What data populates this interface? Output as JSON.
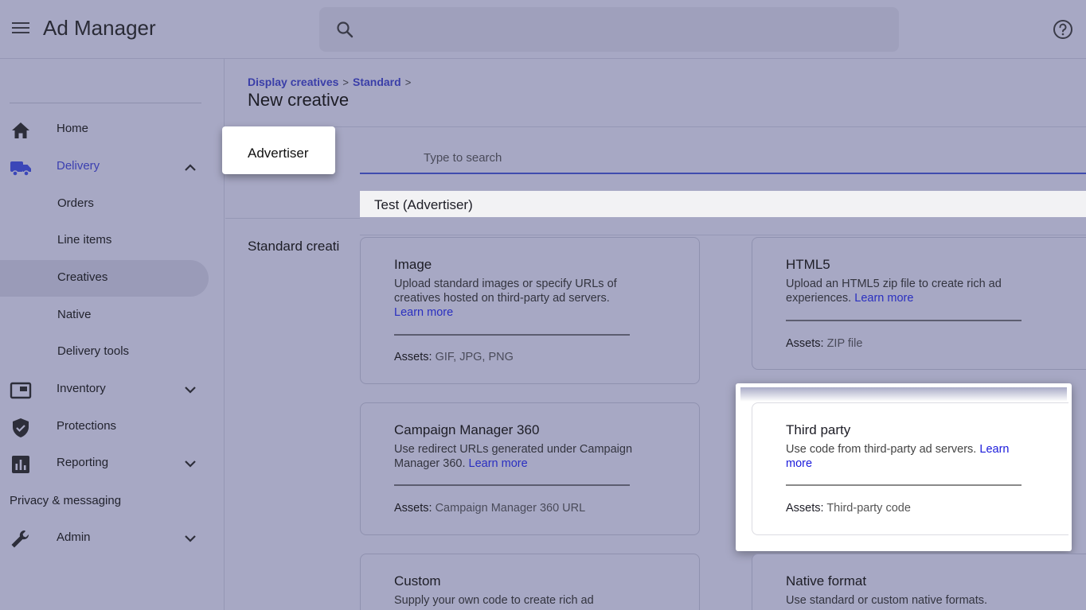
{
  "header": {
    "app_title": "Ad Manager",
    "search_placeholder": "",
    "icons": {
      "menu": "menu-icon",
      "search": "search-icon",
      "help": "help-icon"
    }
  },
  "sidebar": {
    "items": [
      {
        "label": "Home",
        "icon": "home-icon"
      },
      {
        "label": "Delivery",
        "icon": "truck-icon",
        "expanded": true
      },
      {
        "label": "Orders"
      },
      {
        "label": "Line items"
      },
      {
        "label": "Creatives",
        "selected": true
      },
      {
        "label": "Native"
      },
      {
        "label": "Delivery tools"
      },
      {
        "label": "Inventory",
        "icon": "inventory-icon"
      },
      {
        "label": "Protections",
        "icon": "shield-icon"
      },
      {
        "label": "Reporting",
        "icon": "bar-chart-icon"
      },
      {
        "label": "Privacy & messaging"
      },
      {
        "label": "Admin",
        "icon": "wrench-icon"
      }
    ]
  },
  "breadcrumb": {
    "items": [
      "Display creatives",
      "Standard"
    ],
    "separator": ">"
  },
  "page_title": "New creative",
  "advertiser": {
    "label": "Advertiser",
    "search_placeholder": "Type to search",
    "options": [
      "Test (Advertiser)"
    ]
  },
  "section_label": "Standard creati",
  "cards": [
    {
      "title": "Image",
      "description": "Upload standard images or specify URLs of creatives hosted on third-party ad servers.",
      "link": "Learn more",
      "assets_label": "Assets:",
      "assets_value": "GIF, JPG, PNG"
    },
    {
      "title": "HTML5",
      "description": "Upload an HTML5 zip file to create rich ad experiences.",
      "link": "Learn more",
      "assets_label": "Assets:",
      "assets_value": "ZIP file"
    },
    {
      "title": "Campaign Manager 360",
      "description": "Use redirect URLs generated under Campaign Manager 360.",
      "link": "Learn more",
      "assets_label": "Assets:",
      "assets_value": "Campaign Manager 360 URL"
    },
    {
      "title": "Third party",
      "description": "Use code from third-party ad servers.",
      "link": "Learn more",
      "assets_label": "Assets:",
      "assets_value": "Third-party code"
    },
    {
      "title": "Custom",
      "description": "Supply your own code to create rich ad"
    },
    {
      "title": "Native format",
      "description": "Use standard or custom native formats."
    }
  ],
  "colors": {
    "overlay_background": "#a7a8c4",
    "accent": "#3b3fb0",
    "link": "#2a2fc0",
    "highlight": "#ffffff"
  }
}
